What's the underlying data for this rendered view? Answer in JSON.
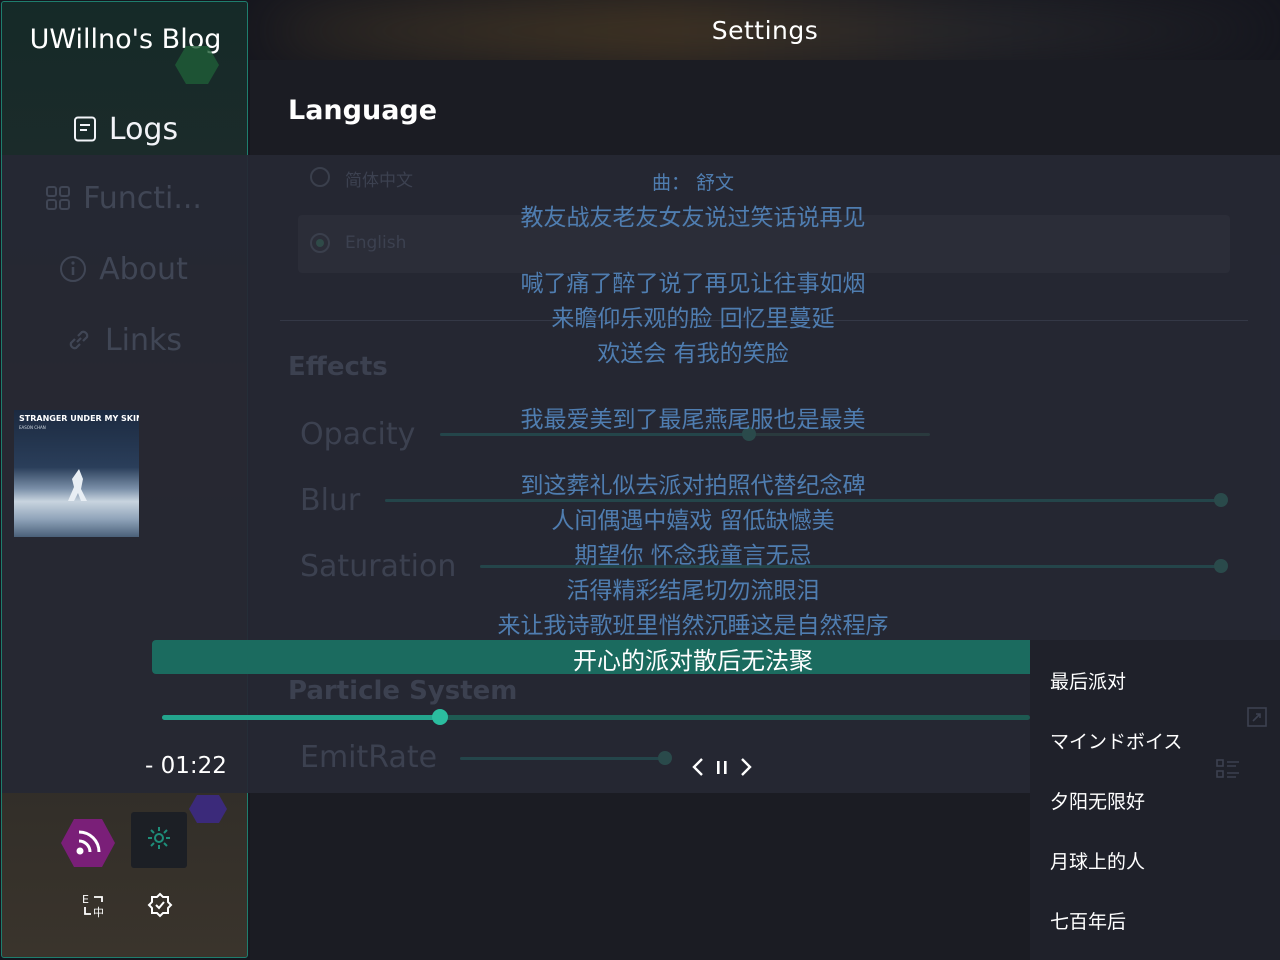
{
  "sidebar": {
    "title": "UWillno's Blog",
    "nav": [
      {
        "label": "Logs",
        "icon": "document-icon"
      },
      {
        "label": "Functi...",
        "icon": "grid-icon"
      },
      {
        "label": "About",
        "icon": "info-icon"
      },
      {
        "label": "Links",
        "icon": "link-icon"
      }
    ]
  },
  "header": {
    "title": "Settings"
  },
  "settings": {
    "language_title": "Language",
    "languages": [
      "简体中文",
      "English"
    ],
    "selected_language": "English",
    "effects_title": "Effects",
    "effects": [
      {
        "label": "Opacity",
        "level": 0.63
      },
      {
        "label": "Blur",
        "level": 1.0
      },
      {
        "label": "Saturation",
        "level": 1.0
      }
    ],
    "particle_title": "Particle System",
    "particle": [
      {
        "label": "EmitRate",
        "level": 1.0
      }
    ]
  },
  "player": {
    "album": {
      "title": "STRANGER UNDER MY SKIN",
      "artist": "EASON CHAN"
    },
    "lyrics": [
      "曲： 舒文",
      "教友战友老友女友说过笑话说再见",
      "喊了痛了醉了说了再见让往事如烟",
      "来瞻仰乐观的脸 回忆里蔓延",
      "欢送会 有我的笑脸",
      "我最爱美到了最尾燕尾服也是最美",
      "到这葬礼似去派对拍照代替纪念碑",
      "人间偶遇中嬉戏 留低缺憾美",
      "期望你 怀念我童言无忌",
      "活得精彩结尾切勿流眼泪",
      "来让我诗歌班里悄然沉睡这是自然程序"
    ],
    "current_lyric": "开心的派对散后无法聚",
    "time": "- 01:22",
    "progress": 0.32
  },
  "playlist": {
    "items": [
      "最后派对",
      "マインドボイス",
      "夕阳无限好",
      "月球上的人",
      "七百年后"
    ]
  },
  "colors": {
    "accent": "#1b6b5f",
    "progress": "#23a58d",
    "lyric": "#4f7db0",
    "sidebar_border": "#1e7e6e"
  }
}
